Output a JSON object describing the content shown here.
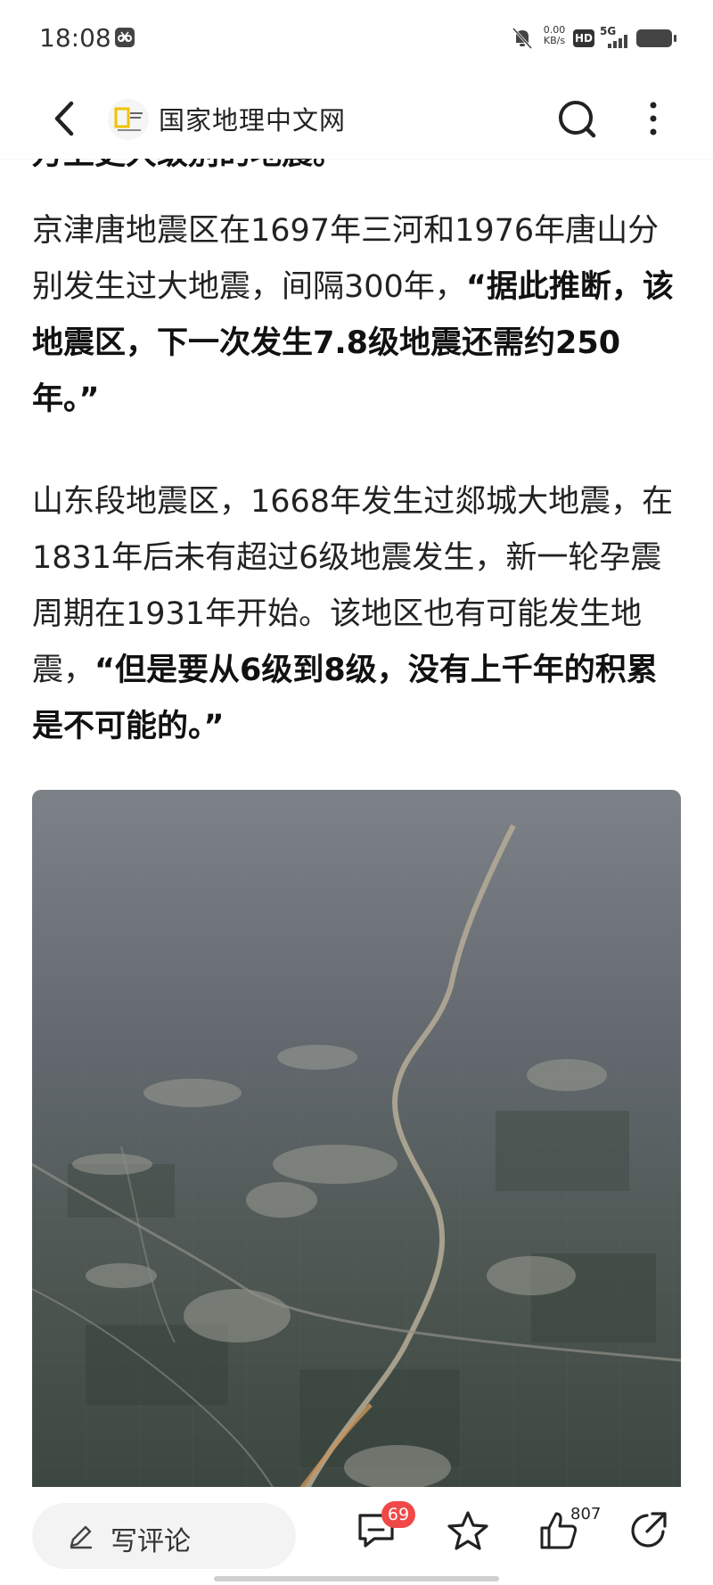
{
  "status_bar": {
    "time": "18:08",
    "net_speed_value": "0.00",
    "net_speed_unit": "KB/s",
    "hd_label": "HD",
    "signal_label": "5G"
  },
  "nav": {
    "site_name": "国家地理中文网",
    "icons": [
      "back-arrow-icon",
      "national-geographic-logo",
      "search-icon",
      "more-vertical-icon"
    ]
  },
  "article": {
    "cut_line": "万上更大级别的地震。",
    "p1_normal": "京津唐地震区在1697年三河和1976年唐山分别发生过大地震，间隔300年，",
    "p1_bold": "“据此推断，该地震区，下一次发生7.8级地震还需约250年。”",
    "p2_normal": "山东段地震区，1668年发生过郯城大地震，在1831年后未有超过6级地震发生，新一轮孕震周期在1931年开始。该地区也有可能发生地震，",
    "p2_bold": "“但是要从6级到8级，没有上千年的积累是不可能的。”"
  },
  "bottom_bar": {
    "comment_placeholder": "写评论",
    "comment_count": "69",
    "like_count": "807",
    "icons": [
      "pencil-icon",
      "comment-icon",
      "star-icon",
      "thumbs-up-icon",
      "share-icon"
    ]
  },
  "colors": {
    "badge": "#f04848",
    "text": "#222222",
    "comment_box_bg": "#f3f3f3"
  }
}
